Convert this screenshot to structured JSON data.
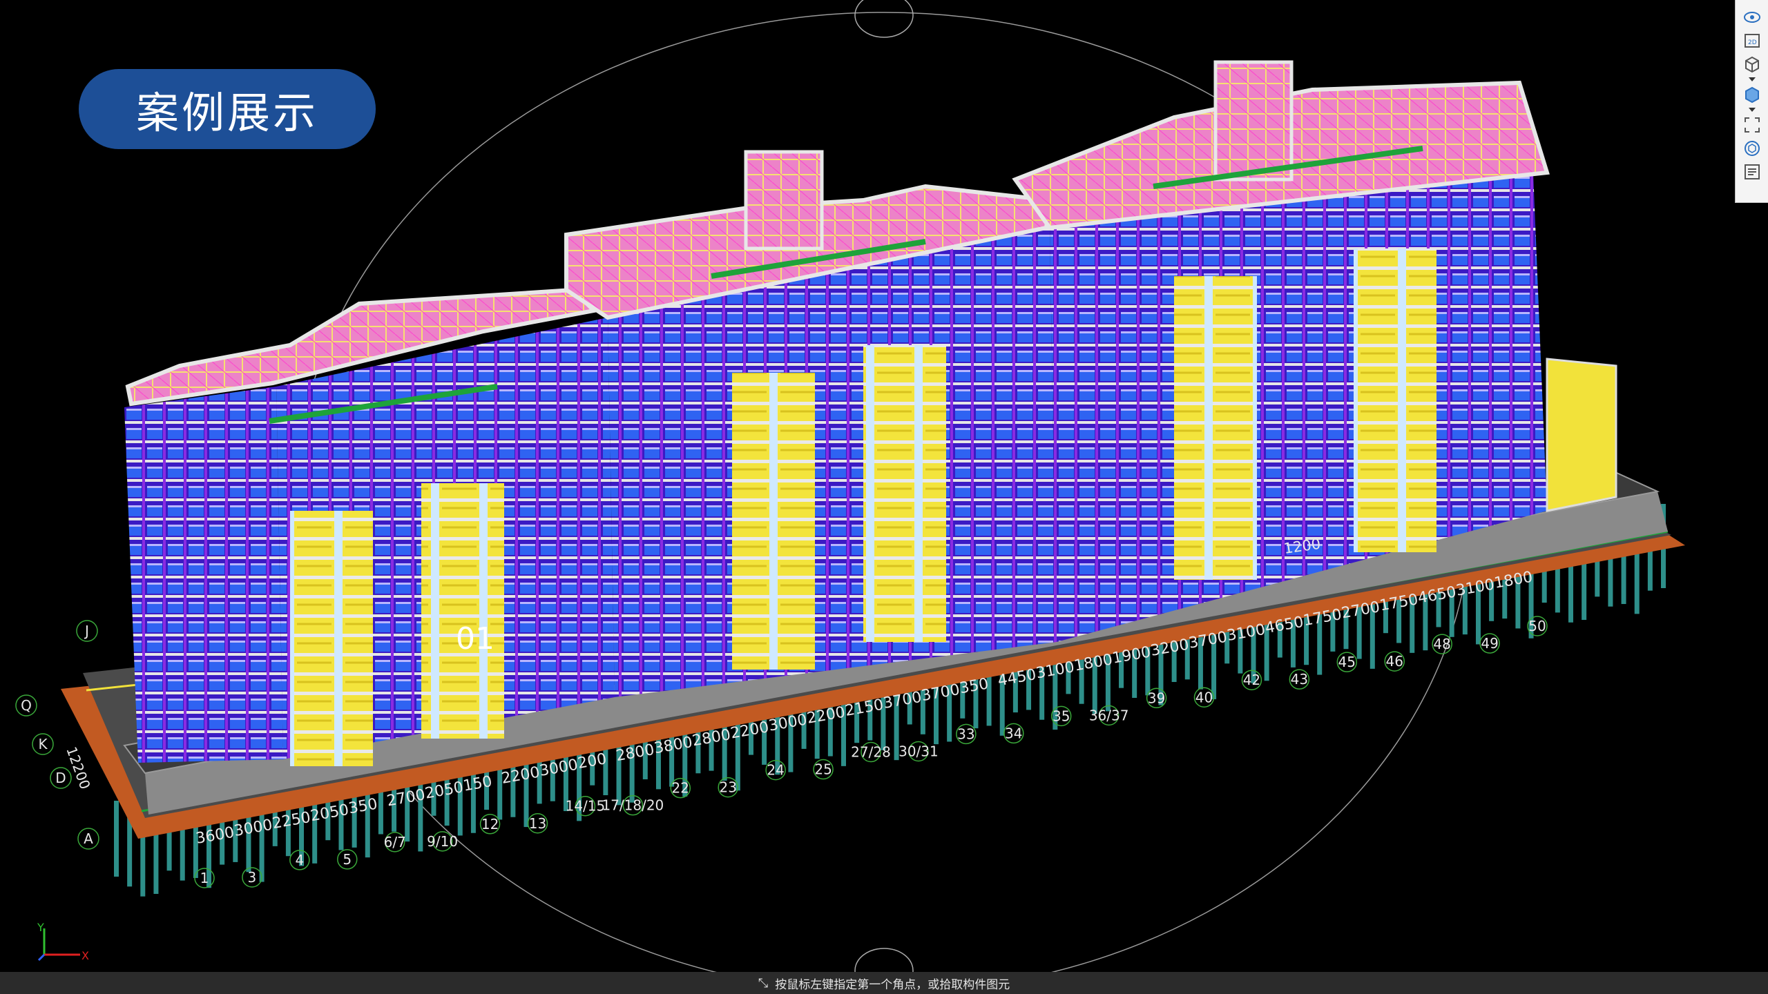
{
  "title": "案例展示",
  "status_hint": "按鼠标左键指定第一个角点，或拾取构件图元",
  "model_label": "01",
  "axis_gizmo": {
    "x": "X",
    "y": "Y"
  },
  "toolbar": {
    "items": [
      "orbit-icon",
      "view-2d-icon",
      "view-3d-icon",
      "display-mode-icon",
      "fit-view-icon",
      "settings-cube-icon",
      "properties-list-icon"
    ],
    "label_2d": "2D"
  },
  "grid_row_labels": [
    "J",
    "Q",
    "K",
    "D",
    "A"
  ],
  "grid_side_dimension": "12200",
  "grid_col_bubbles": [
    "1",
    "3",
    "4",
    "5",
    "6/7",
    "9/10",
    "12",
    "13",
    "14/15",
    "17/18/20",
    "22",
    "23",
    "24",
    "25",
    "27/28",
    "30/31",
    "33",
    "34",
    "35",
    "36/37",
    "39",
    "40",
    "42",
    "43",
    "45",
    "46",
    "48",
    "49",
    "50"
  ],
  "dimensions_front": [
    "3600",
    "3000",
    "2250",
    "2050",
    "350",
    "2700",
    "2050",
    "150",
    "2200",
    "3000",
    "200",
    "2800",
    "3800",
    "2800",
    "2200",
    "3000",
    "2200",
    "2150",
    "3700",
    "3700",
    "350",
    "4450",
    "3100",
    "1800",
    "1900",
    "3200",
    "3700",
    "3100",
    "4650",
    "1750",
    "2700",
    "1750",
    "4650",
    "3100",
    "1800"
  ],
  "dimension_back": "1200",
  "colors": {
    "roof": "#ec83c8",
    "wall": "#5a1fd6",
    "window": "#2a5df0",
    "slab": "#e8e8e8",
    "balcony": "#f2e23a",
    "beam": "#cdd35a",
    "green": "#1ea33a",
    "base": "#4b4b4b",
    "raft": "#c25a22",
    "pile": "#2e8f8a",
    "title_bg": "#1d4f97"
  }
}
